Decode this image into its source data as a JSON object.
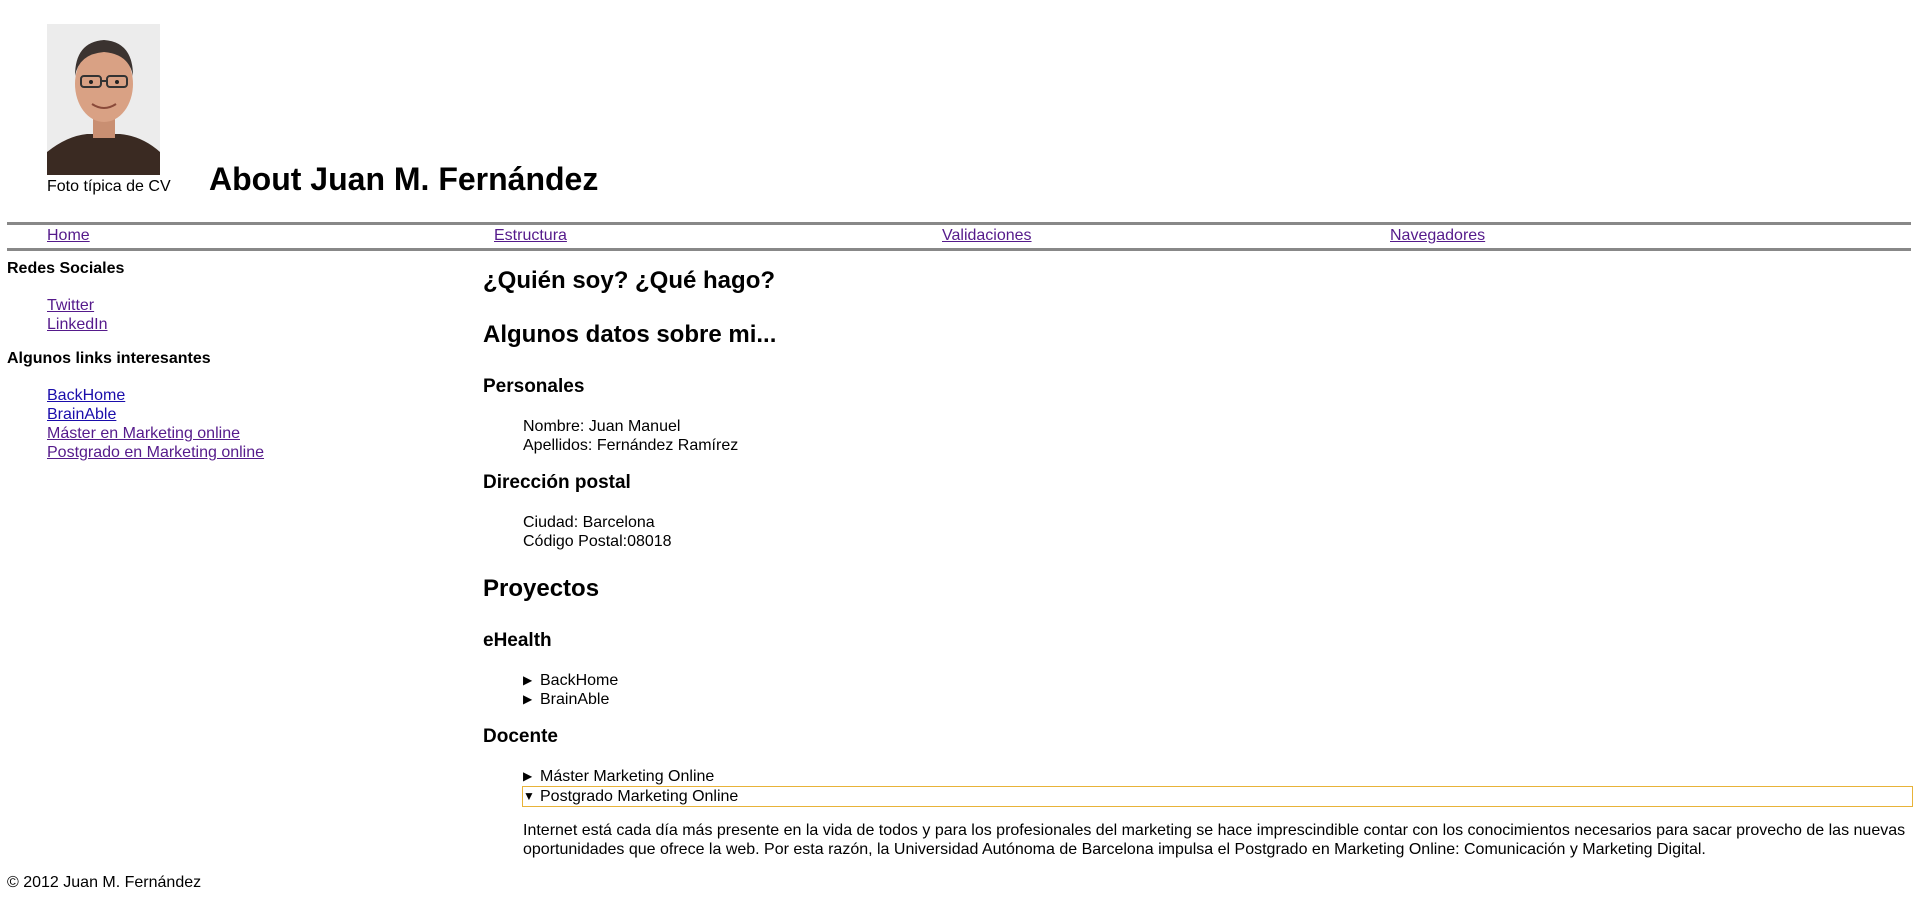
{
  "header": {
    "photo_caption": "Foto típica de CV",
    "title": "About Juan M. Fernández"
  },
  "nav": [
    {
      "label": "Home"
    },
    {
      "label": "Estructura"
    },
    {
      "label": "Validaciones"
    },
    {
      "label": "Navegadores"
    }
  ],
  "sidebar": {
    "social_heading": "Redes Sociales",
    "social_links": [
      {
        "label": "Twitter"
      },
      {
        "label": "LinkedIn"
      }
    ],
    "links_heading": "Algunos links interesantes",
    "links": [
      {
        "label": "BackHome"
      },
      {
        "label": "BrainAble"
      },
      {
        "label": "Máster en Marketing online"
      },
      {
        "label": "Postgrado en Marketing online"
      }
    ]
  },
  "main": {
    "who_heading": "¿Quién soy? ¿Qué hago?",
    "data_heading": "Algunos datos sobre mi...",
    "personal_heading": "Personales",
    "personal": [
      "Nombre: Juan Manuel",
      "Apellidos: Fernández Ramírez"
    ],
    "address_heading": "Dirección postal",
    "address": [
      "Ciudad: Barcelona",
      "Código Postal:08018"
    ],
    "projects_heading": "Proyectos",
    "ehealth_heading": "eHealth",
    "ehealth_items": [
      {
        "label": "BackHome",
        "marker": "▶"
      },
      {
        "label": "BrainAble",
        "marker": "▶"
      }
    ],
    "teaching_heading": "Docente",
    "teaching_items": [
      {
        "label": "Máster Marketing Online",
        "marker": "▶"
      },
      {
        "label": "Postgrado Marketing Online",
        "marker": "▼"
      }
    ],
    "postgrado_text": "Internet está cada día más presente en la vida de todos y para los profesionales del marketing se hace imprescindible contar con los conocimientos necesarios para sacar provecho de las nuevas oportunidades que ofrece la web. Por esta razón, la Universidad Autónoma de Barcelona impulsa el Postgrado en Marketing Online: Comunicación y Marketing Digital."
  },
  "footer": {
    "text": "© 2012 Juan M. Fernández"
  }
}
